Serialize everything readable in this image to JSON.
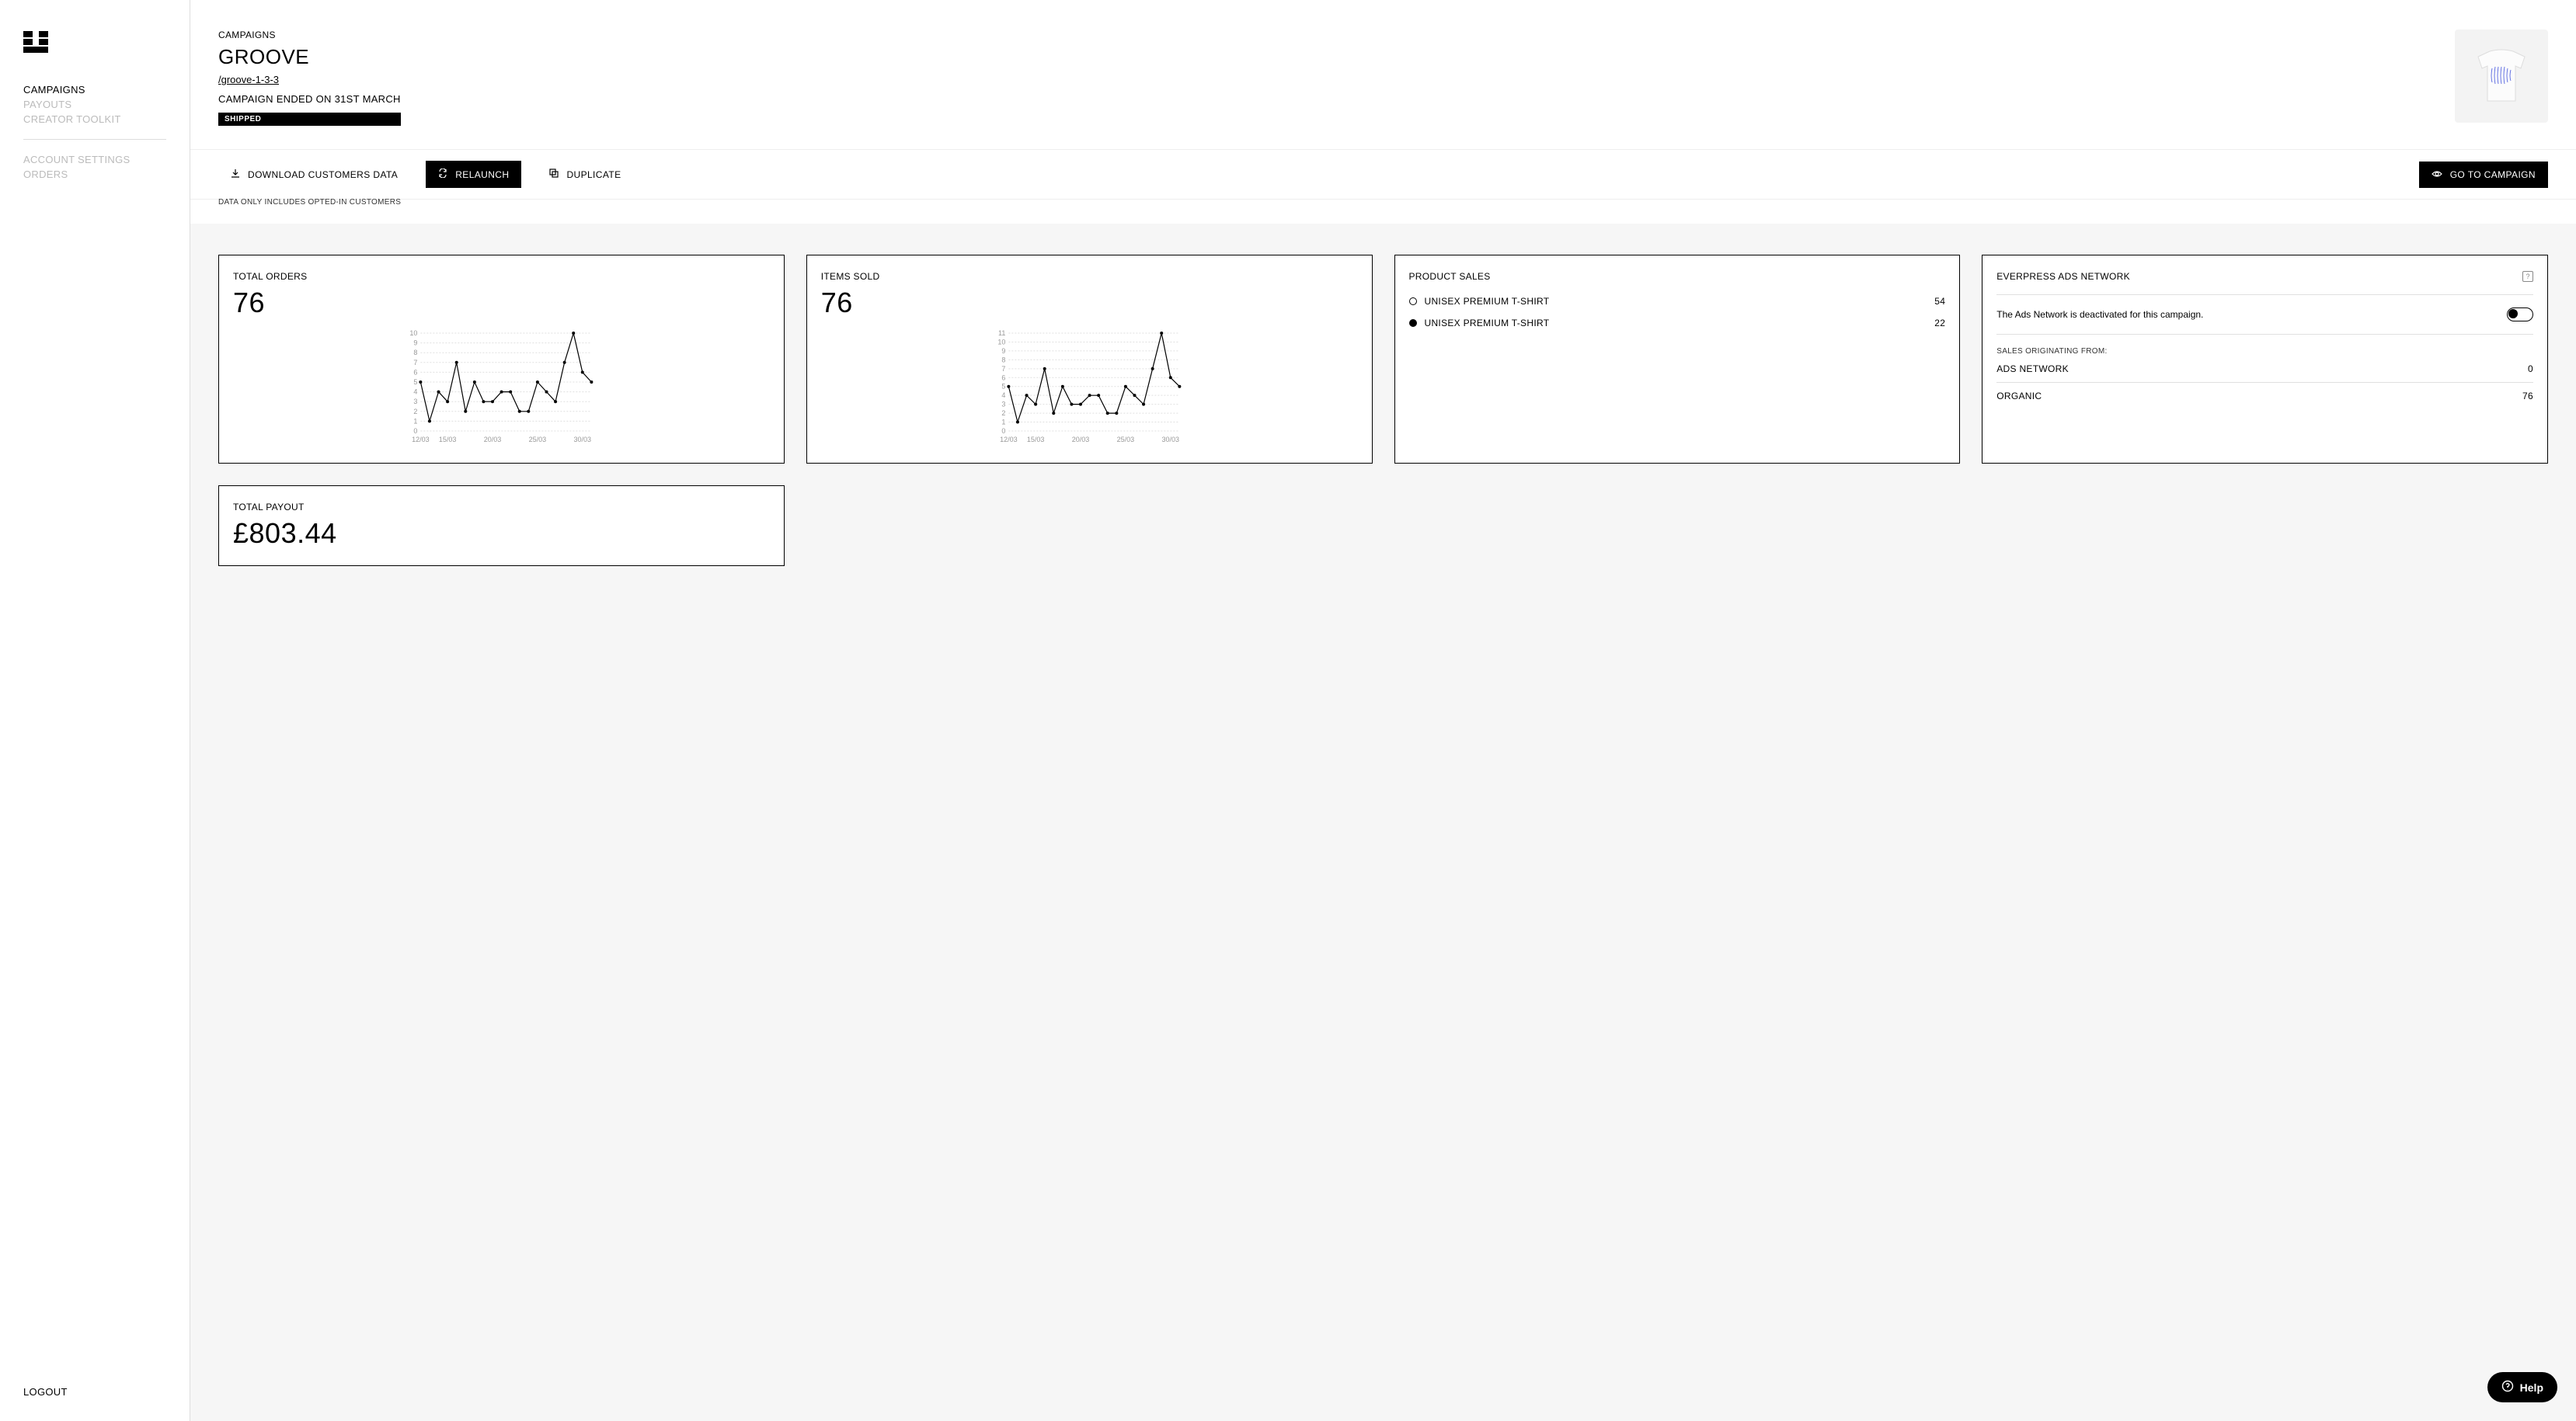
{
  "sidebar": {
    "nav": [
      {
        "label": "CAMPAIGNS",
        "active": true
      },
      {
        "label": "PAYOUTS",
        "active": false
      },
      {
        "label": "CREATOR TOOLKIT",
        "active": false
      }
    ],
    "nav2": [
      {
        "label": "ACCOUNT SETTINGS"
      },
      {
        "label": "ORDERS"
      }
    ],
    "logout": "LOGOUT"
  },
  "header": {
    "breadcrumb": "CAMPAIGNS",
    "title": "GROOVE",
    "slug": "/groove-1-3-3",
    "status": "CAMPAIGN ENDED ON 31ST MARCH",
    "badge": "SHIPPED"
  },
  "actions": {
    "download": "DOWNLOAD CUSTOMERS DATA",
    "relaunch": "RELAUNCH",
    "duplicate": "DUPLICATE",
    "goto": "GO TO CAMPAIGN",
    "disclaimer": "DATA ONLY INCLUDES OPTED-IN CUSTOMERS"
  },
  "cards": {
    "total_orders": {
      "label": "TOTAL ORDERS",
      "value": "76"
    },
    "items_sold": {
      "label": "ITEMS SOLD",
      "value": "76"
    },
    "product_sales": {
      "label": "PRODUCT SALES",
      "items": [
        {
          "name": "UNISEX PREMIUM T-SHIRT",
          "count": "54",
          "filled": false
        },
        {
          "name": "UNISEX PREMIUM T-SHIRT",
          "count": "22",
          "filled": true
        }
      ]
    },
    "ads": {
      "label": "EVERPRESS ADS NETWORK",
      "desc": "The Ads Network is deactivated for this campaign.",
      "sub": "SALES ORIGINATING FROM:",
      "rows": [
        {
          "name": "ADS NETWORK",
          "value": "0"
        },
        {
          "name": "ORGANIC",
          "value": "76"
        }
      ]
    },
    "payout": {
      "label": "TOTAL PAYOUT",
      "value": "£803.44"
    }
  },
  "chart_data": [
    {
      "type": "line",
      "title": "TOTAL ORDERS",
      "xlabel": "",
      "ylabel": "",
      "ylim": [
        0,
        10
      ],
      "x_ticks": [
        "12/03",
        "15/03",
        "20/03",
        "25/03",
        "30/03"
      ],
      "y_ticks": [
        0,
        1,
        2,
        3,
        4,
        5,
        6,
        7,
        8,
        9,
        10
      ],
      "categories": [
        "12/03",
        "13/03",
        "14/03",
        "15/03",
        "16/03",
        "17/03",
        "18/03",
        "19/03",
        "20/03",
        "21/03",
        "22/03",
        "23/03",
        "24/03",
        "25/03",
        "26/03",
        "27/03",
        "28/03",
        "29/03",
        "30/03",
        "31/03"
      ],
      "values": [
        5,
        1,
        4,
        3,
        7,
        2,
        5,
        3,
        3,
        4,
        4,
        2,
        2,
        5,
        4,
        3,
        7,
        10,
        6,
        5
      ]
    },
    {
      "type": "line",
      "title": "ITEMS SOLD",
      "xlabel": "",
      "ylabel": "",
      "ylim": [
        0,
        11
      ],
      "x_ticks": [
        "12/03",
        "15/03",
        "20/03",
        "25/03",
        "30/03"
      ],
      "y_ticks": [
        0,
        1,
        2,
        3,
        4,
        5,
        6,
        7,
        8,
        9,
        10,
        11
      ],
      "categories": [
        "12/03",
        "13/03",
        "14/03",
        "15/03",
        "16/03",
        "17/03",
        "18/03",
        "19/03",
        "20/03",
        "21/03",
        "22/03",
        "23/03",
        "24/03",
        "25/03",
        "26/03",
        "27/03",
        "28/03",
        "29/03",
        "30/03",
        "31/03"
      ],
      "values": [
        5,
        1,
        4,
        3,
        7,
        2,
        5,
        3,
        3,
        4,
        4,
        2,
        2,
        5,
        4,
        3,
        7,
        11,
        6,
        5
      ]
    }
  ],
  "help": {
    "label": "Help"
  }
}
